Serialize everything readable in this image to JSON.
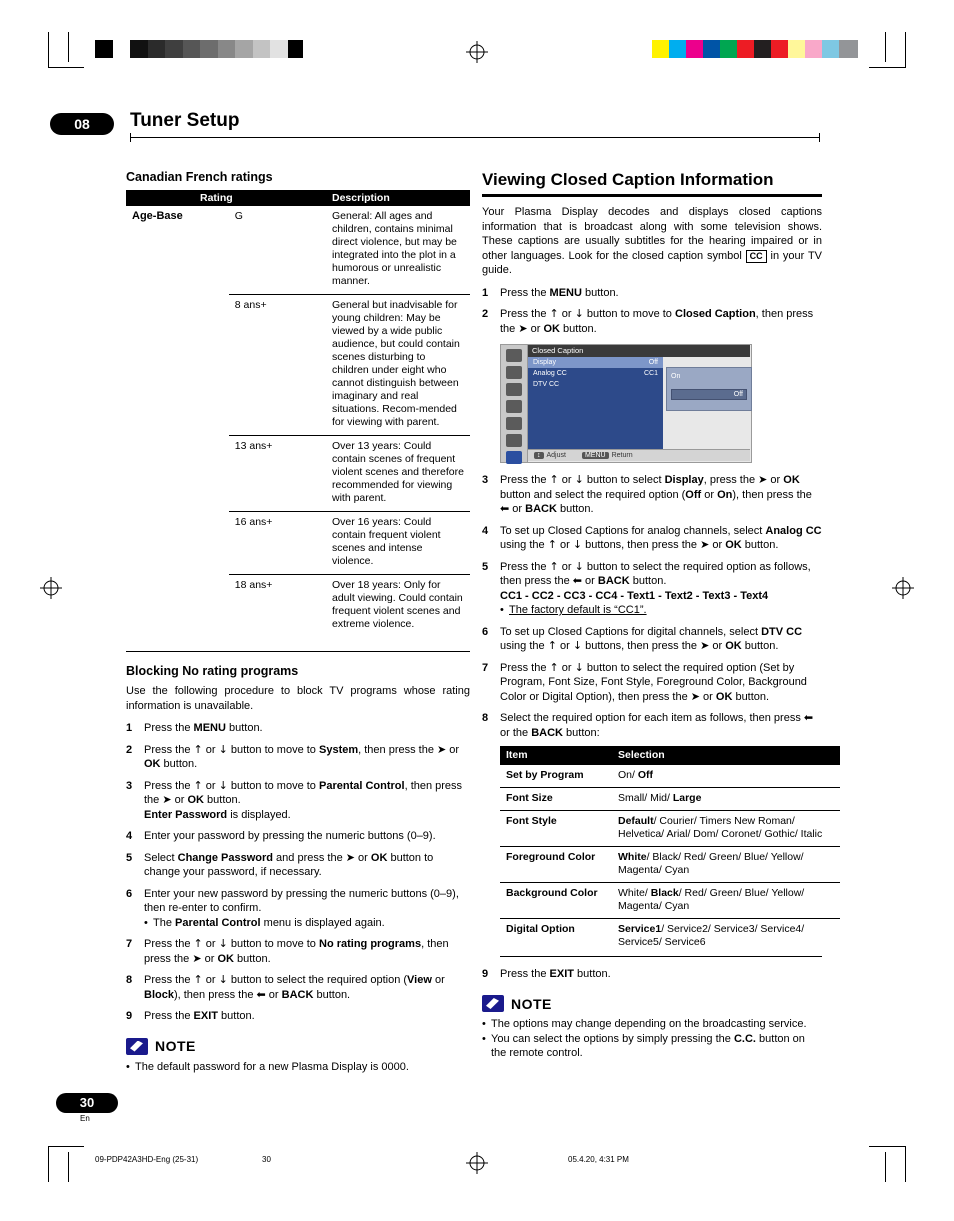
{
  "header": {
    "chapter_number": "08",
    "chapter_title": "Tuner Setup"
  },
  "left": {
    "heading": "Canadian French ratings",
    "table": {
      "headers": [
        "Rating",
        "Description"
      ],
      "age_base_label": "Age-Base",
      "rows": [
        {
          "rating": "G",
          "description": "General: All ages and children, contains minimal direct violence, but may be integrated into the plot in a humorous or unrealistic manner."
        },
        {
          "rating": "8 ans+",
          "description": "General but inadvisable for young children: May be viewed by a wide public audience, but could contain scenes disturbing to children under eight who cannot distinguish between imaginary and real situations. Recom-mended for viewing with parent."
        },
        {
          "rating": "13 ans+",
          "description": "Over 13 years: Could contain scenes of frequent violent scenes and therefore recommended for viewing with parent."
        },
        {
          "rating": "16 ans+",
          "description": "Over 16 years: Could contain frequent violent scenes and intense violence."
        },
        {
          "rating": "18 ans+",
          "description": "Over 18 years: Only for adult viewing. Could contain frequent violent scenes and extreme violence."
        }
      ]
    },
    "blocking": {
      "heading": "Blocking No rating programs",
      "intro": "Use the following procedure to block TV programs whose rating information is unavailable.",
      "steps": [
        "Press the MENU button.",
        "Press the ↑ or ↓ button to move to System, then press the ➡ or OK button.",
        "Press the ↑ or ↓ button to move to Parental Control, then press the ➡ or OK button. Enter Password is displayed.",
        "Enter your password by pressing the numeric buttons (0–9).",
        "Select Change Password and press the ➡ or OK button to change your password, if necessary.",
        "Enter your new password by pressing the numeric buttons (0–9), then re-enter to confirm.",
        "Press the ↑ or ↓ button to move to No rating programs, then press the ➡ or OK button.",
        "Press the ↑ or ↓ button to select the required option (View or Block), then press the ⬅ or BACK button.",
        "Press the EXIT button."
      ],
      "step6_bullet": "The Parental Control menu is displayed again."
    },
    "note": {
      "title": "NOTE",
      "items": [
        "The default password for a new Plasma Display is 0000."
      ]
    }
  },
  "right": {
    "heading": "Viewing Closed Caption Information",
    "intro_1": "Your Plasma Display decodes and displays closed captions information that is broadcast along with some television shows. These captions are usually subtitles for the hearing impaired or in other languages. Look for the closed caption symbol",
    "cc_symbol": "CC",
    "intro_2": "in your TV guide.",
    "steps": [
      "Press the MENU button.",
      "Press the ↑ or ↓ button to move to Closed Caption, then press the ➡ or OK button.",
      "Press the ↑ or ↓ button to select Display, press the ➡ or OK button and select the required option (Off or On), then press the ⬅ or BACK button.",
      "To set up Closed Captions for analog channels, select Analog CC using the ↑ or ↓ buttons, then press the ➡ or OK button.",
      "Press the ↑ or ↓ button to select the required option as follows, then press the ⬅ or BACK button.",
      "To set up Closed Captions for digital channels, select DTV CC using the ↑ or ↓ buttons, then press the ➡ or OK button.",
      "Press the ↑ or ↓ button to select the required option (Set by Program, Font Size, Font Style, Foreground Color, Background Color or Digital Option), then press the ➡ or OK button.",
      "Select the required option for each item as follows, then press ⬅ or the BACK button:",
      "Press the EXIT button."
    ],
    "step5_options": "CC1 - CC2 - CC3 - CC4 - Text1 - Text2 - Text3 - Text4",
    "step5_bullet": "The factory default is “CC1”.",
    "osd": {
      "title": "Closed Caption",
      "rows": [
        {
          "label": "Display",
          "value": "Off"
        },
        {
          "label": "Analog CC",
          "value": "CC1"
        },
        {
          "label": "DTV CC",
          "value": ""
        }
      ],
      "panel_value": "On",
      "panel_bar": "Off",
      "footer_adjust": "Adjust",
      "footer_return": "Return",
      "footer_adjust_key": "↕",
      "footer_return_key": "MENU"
    },
    "table": {
      "headers": [
        "Item",
        "Selection"
      ],
      "rows": [
        {
          "item": "Set by Program",
          "selection": "On/ Off",
          "bold": [
            "Off"
          ]
        },
        {
          "item": "Font Size",
          "selection": "Small/ Mid/ Large",
          "bold": [
            "Large"
          ]
        },
        {
          "item": "Font Style",
          "selection": "Default/ Courier/ Timers New Roman/ Helvetica/ Arial/ Dom/ Coronet/ Gothic/ Italic",
          "bold": [
            "Default"
          ]
        },
        {
          "item": "Foreground Color",
          "selection": "White/ Black/ Red/ Green/ Blue/ Yellow/ Magenta/ Cyan",
          "bold": [
            "White"
          ]
        },
        {
          "item": "Background Color",
          "selection": "White/ Black/ Red/ Green/ Blue/ Yellow/ Magenta/ Cyan",
          "bold": [
            "Black"
          ]
        },
        {
          "item": "Digital Option",
          "selection": "Service1/ Service2/ Service3/ Service4/ Service5/ Service6",
          "bold": [
            "Service1"
          ]
        }
      ]
    },
    "note": {
      "title": "NOTE",
      "items": [
        "The options may change depending on the broadcasting service.",
        "You can select the options by simply pressing the C.C. button on the remote control."
      ]
    }
  },
  "footer": {
    "page_number": "30",
    "language": "En",
    "file_id": "09-PDP42A3HD-Eng (25-31)",
    "page_mark": "30",
    "timestamp": "05.4.20, 4:31 PM"
  },
  "colors": {
    "accent": "#000000",
    "osd_menu": "#2d4a8a",
    "note_icon": "#1a1a8c"
  }
}
